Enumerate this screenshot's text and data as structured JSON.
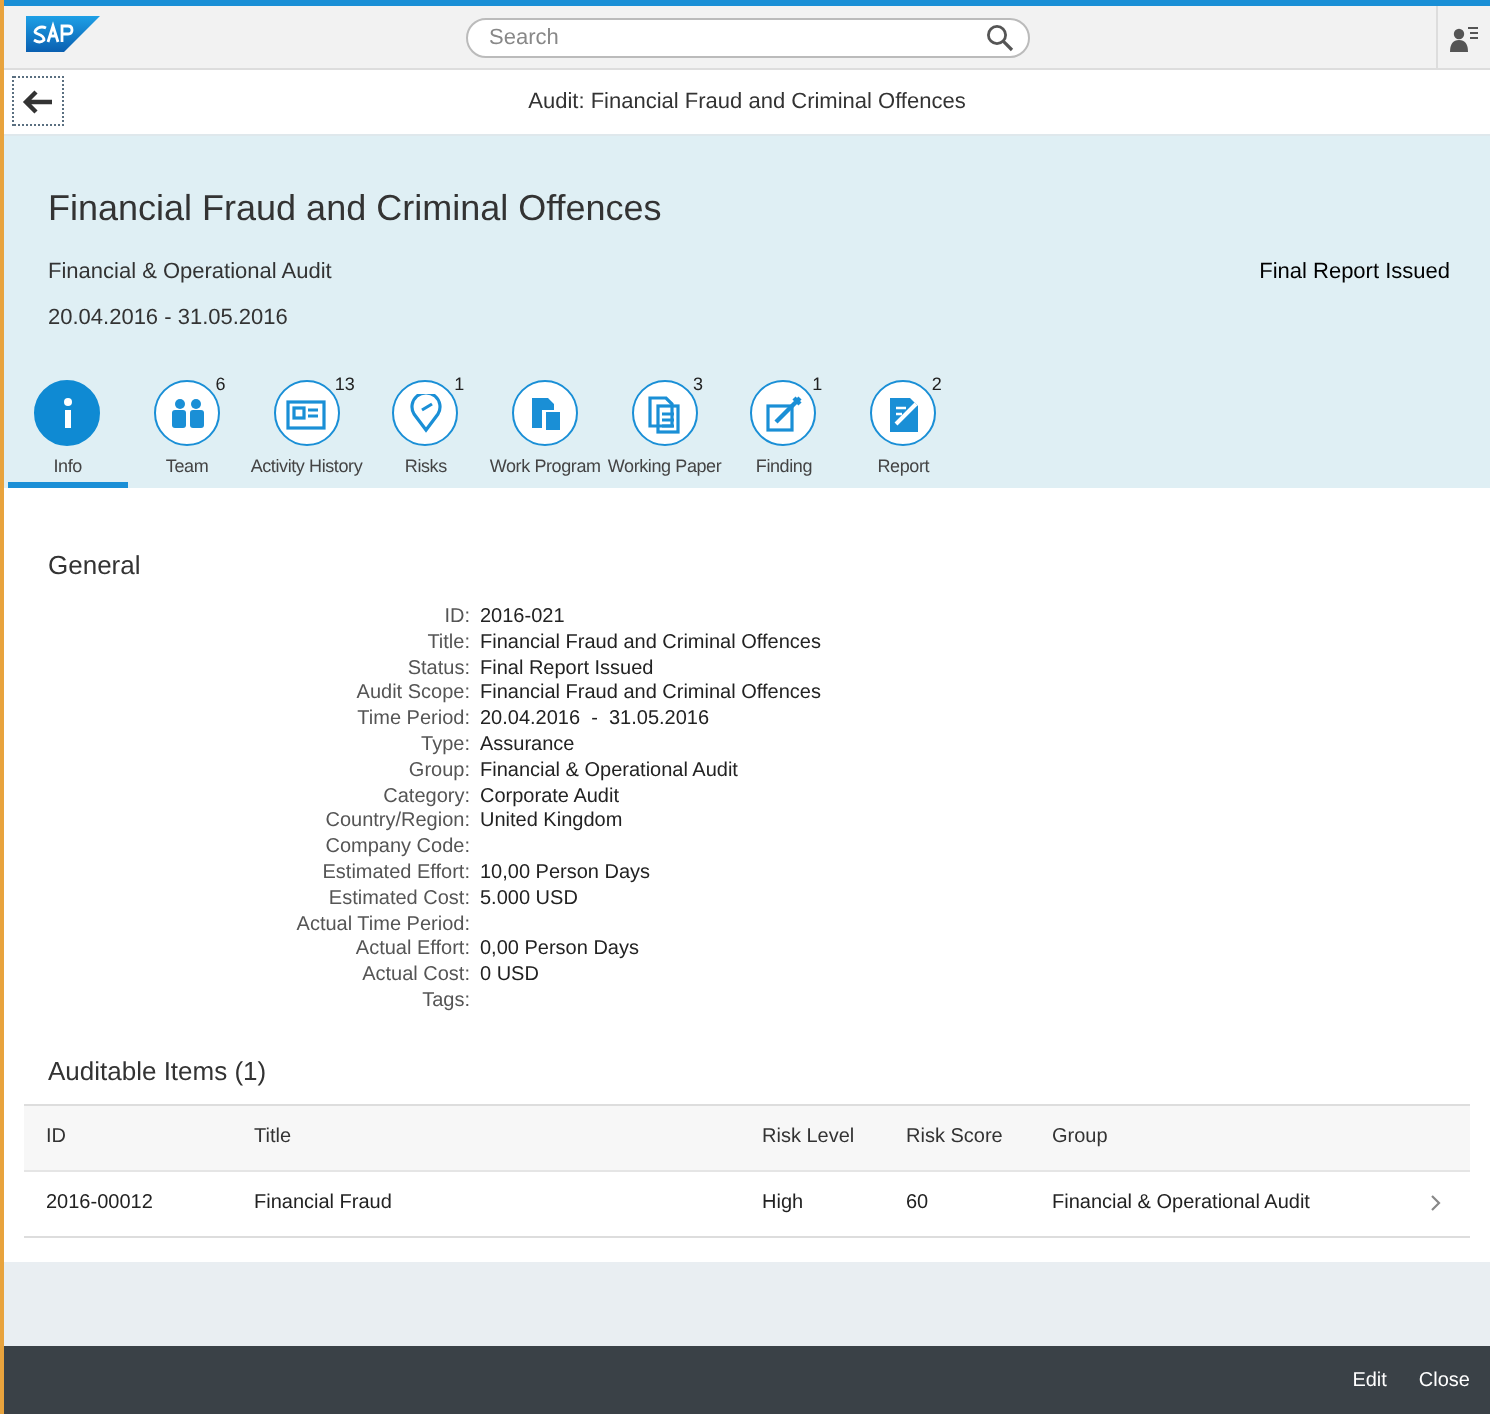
{
  "shell": {
    "search": {
      "placeholder": "Search"
    }
  },
  "nav": {
    "title": "Audit: Financial Fraud and Criminal Offences"
  },
  "header": {
    "title": "Financial Fraud and Criminal Offences",
    "subtitle": "Financial & Operational Audit",
    "period": "20.04.2016 - 31.05.2016",
    "status": "Final Report Issued"
  },
  "tabs": [
    {
      "label": "Info",
      "selected": true
    },
    {
      "label": "Team",
      "count": "6",
      "selected": false
    },
    {
      "label": "Activity History",
      "count": "13",
      "selected": false
    },
    {
      "label": "Risks",
      "count": "1",
      "selected": false
    },
    {
      "label": "Work Program",
      "selected": false
    },
    {
      "label": "Working Paper",
      "count": "3",
      "selected": false
    },
    {
      "label": "Finding",
      "count": "1",
      "selected": false
    },
    {
      "label": "Report",
      "count": "2",
      "selected": false
    }
  ],
  "general": {
    "title": "General",
    "fields": [
      {
        "label": "ID:",
        "value": "2016-021"
      },
      {
        "label": "Title:",
        "value": "Financial Fraud and Criminal Offences"
      },
      {
        "label": "Status:",
        "value": "Final Report Issued"
      },
      {
        "label": "Audit Scope:",
        "value": "Financial Fraud and Criminal Offences"
      },
      {
        "label": "Time Period:",
        "value": "20.04.2016  -  31.05.2016"
      },
      {
        "label": "Type:",
        "value": "Assurance"
      },
      {
        "label": "Group:",
        "value": "Financial & Operational Audit"
      },
      {
        "label": "Category:",
        "value": "Corporate Audit"
      },
      {
        "label": "Country/Region:",
        "value": "United Kingdom"
      },
      {
        "label": "Company Code:"
      },
      {
        "label": "Estimated Effort:",
        "value": "10,00 Person Days"
      },
      {
        "label": "Estimated Cost:",
        "value": "5.000 USD"
      },
      {
        "label": "Actual Time Period:"
      },
      {
        "label": "Actual Effort:",
        "value": "0,00 Person Days"
      },
      {
        "label": "Actual Cost:",
        "value": "0 USD"
      },
      {
        "label": "Tags:"
      }
    ]
  },
  "auditable_items": {
    "title": "Auditable Items (1)",
    "columns": [
      "ID",
      "Title",
      "Risk Level",
      "Risk Score",
      "Group"
    ],
    "rows": [
      [
        "2016-00012",
        "Financial Fraud",
        "High",
        "60",
        "Financial & Operational Audit"
      ]
    ]
  },
  "footer": {
    "buttons": [
      "Edit",
      "Close"
    ]
  }
}
